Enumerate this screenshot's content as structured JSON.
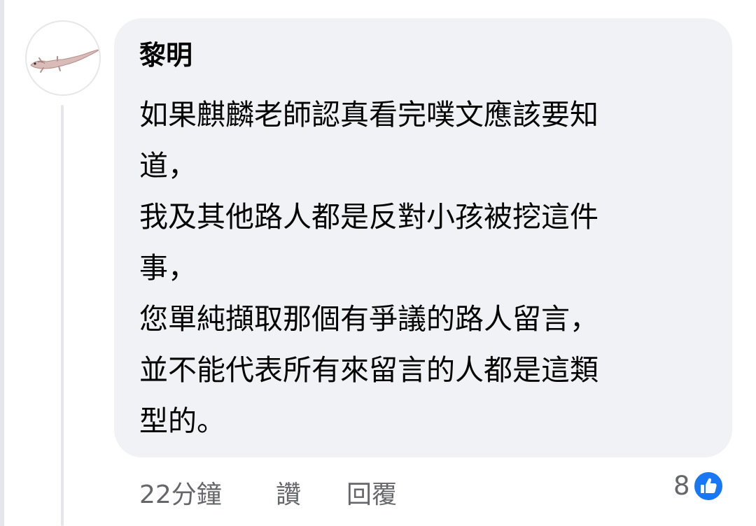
{
  "comment": {
    "author": "黎明",
    "lines": [
      "如果麒麟老師認真看完噗文應該要知",
      "道，",
      "我及其他路人都是反對小孩被挖這件",
      "事，",
      "您單純擷取那個有爭議的路人留言，",
      "並不能代表所有來留言的人都是這類",
      "型的。"
    ],
    "time": "22分鐘",
    "like_label": "讚",
    "reply_label": "回覆",
    "reaction_count": "8",
    "reaction_icon": "thumbs-up-icon"
  },
  "colors": {
    "bubble": "#f0f2f5",
    "text": "#050505",
    "meta": "#65676b",
    "like_blue": "#1877f2"
  }
}
